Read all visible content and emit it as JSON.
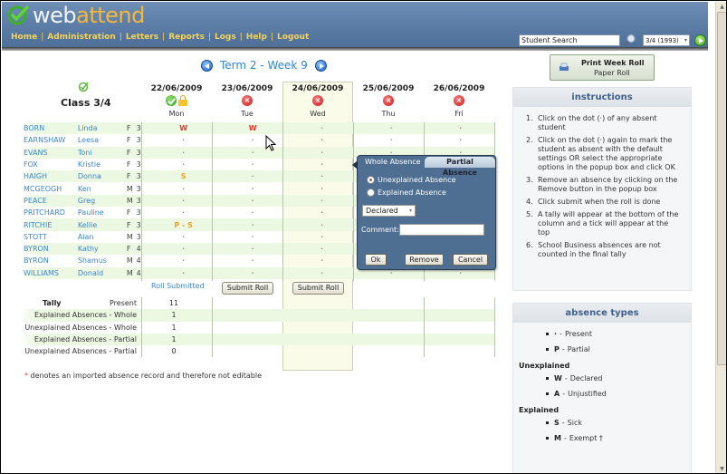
{
  "app": {
    "logo_part1": "web",
    "logo_part2": "attend"
  },
  "nav": {
    "items": [
      "Home",
      "Administration",
      "Letters",
      "Reports",
      "Logs",
      "Help",
      "Logout"
    ],
    "separator": "|"
  },
  "search": {
    "value": "Student Search",
    "placeholder": "Student Search"
  },
  "class_select": {
    "selected": "3/4 (1993)"
  },
  "week": {
    "title": "Term 2 - Week 9"
  },
  "class": {
    "title": "Class 3/4"
  },
  "days": [
    {
      "date": "22/06/2009",
      "name": "Mon",
      "status": "submitted",
      "locked": true
    },
    {
      "date": "23/06/2009",
      "name": "Tue",
      "status": "not-submitted",
      "locked": false
    },
    {
      "date": "24/06/2009",
      "name": "Wed",
      "status": "not-submitted",
      "locked": false
    },
    {
      "date": "25/06/2009",
      "name": "Thu",
      "status": "not-submitted",
      "locked": false
    },
    {
      "date": "26/06/2009",
      "name": "Fri",
      "status": "not-submitted",
      "locked": false
    }
  ],
  "students": [
    {
      "last": "BORN",
      "first": "Linda",
      "gender": "F",
      "year": "3",
      "marks": [
        "W",
        "W",
        "·",
        "·",
        "·"
      ]
    },
    {
      "last": "EARNSHAW",
      "first": "Leesa",
      "gender": "F",
      "year": "3",
      "marks": [
        "·",
        "·",
        "·",
        "·",
        "·"
      ]
    },
    {
      "last": "EVANS",
      "first": "Toni",
      "gender": "F",
      "year": "3",
      "marks": [
        "·",
        "·",
        "·",
        "·",
        "·"
      ]
    },
    {
      "last": "FOX",
      "first": "Kristie",
      "gender": "F",
      "year": "3",
      "marks": [
        "·",
        "·",
        "·",
        "·",
        "·"
      ]
    },
    {
      "last": "HAIGH",
      "first": "Donna",
      "gender": "F",
      "year": "3",
      "marks": [
        "S",
        "·",
        "·",
        "·",
        "·"
      ]
    },
    {
      "last": "MCGEOGH",
      "first": "Ken",
      "gender": "M",
      "year": "3",
      "marks": [
        "·",
        "·",
        "·",
        "·",
        "·"
      ]
    },
    {
      "last": "PEACE",
      "first": "Greg",
      "gender": "M",
      "year": "3",
      "marks": [
        "·",
        "·",
        "·",
        "·",
        "·"
      ]
    },
    {
      "last": "PRITCHARD",
      "first": "Pauline",
      "gender": "F",
      "year": "3",
      "marks": [
        "·",
        "·",
        "·",
        "·",
        "·"
      ]
    },
    {
      "last": "RITCHIE",
      "first": "Kellie",
      "gender": "F",
      "year": "3",
      "marks": [
        "P - S",
        "·",
        "·",
        "·",
        "·"
      ]
    },
    {
      "last": "STOTT",
      "first": "Alan",
      "gender": "M",
      "year": "3",
      "marks": [
        "·",
        "·",
        "·",
        "·",
        "·"
      ]
    },
    {
      "last": "BYRON",
      "first": "Kathy",
      "gender": "F",
      "year": "4",
      "marks": [
        "·",
        "·",
        "·",
        "·",
        "·"
      ]
    },
    {
      "last": "BYRON",
      "first": "Shamus",
      "gender": "M",
      "year": "4",
      "marks": [
        "·",
        "·",
        "·",
        "·",
        "·"
      ]
    },
    {
      "last": "WILLIAMS",
      "first": "Donald",
      "gender": "M",
      "year": "4",
      "marks": [
        "·",
        "·",
        "·",
        "·",
        "·"
      ]
    }
  ],
  "roll": {
    "submitted_label": "Roll Submitted",
    "submit_label": "Submit Roll"
  },
  "tally": {
    "title": "Tally",
    "rows": [
      {
        "label": "Present",
        "value": "11"
      },
      {
        "label": "Explained Absences - Whole",
        "value": "1"
      },
      {
        "label": "Unexplained Absences - Whole",
        "value": "1"
      },
      {
        "label": "Explained Absences - Partial",
        "value": "1"
      },
      {
        "label": "Unexplained Absences - Partial",
        "value": "0"
      }
    ]
  },
  "footnote": {
    "star": "*",
    "text": "denotes an imported absence record and therefore not editable"
  },
  "popup": {
    "tab_whole": "Whole Absence",
    "tab_partial": "Partial Absence",
    "radio_unexplained": "Unexplained Absence",
    "radio_explained": "Explained Absence",
    "selected_radio": "unexplained",
    "reason_selected": "Declared",
    "comment_label": "Comment:",
    "comment_value": "",
    "ok_label": "Ok",
    "remove_label": "Remove",
    "cancel_label": "Cancel"
  },
  "print": {
    "title": "Print Week Roll",
    "subtitle": "Paper Roll"
  },
  "instructions": {
    "title": "instructions",
    "items": [
      "Click on the dot (·) of any absent student",
      "Click on the dot (·) again to mark the student as absent with the default settings OR select the appropriate options in the popup box and click OK",
      "Remove an absence by clicking on the Remove button in the popup box",
      "Click submit when the roll is done",
      "A tally will appear at the bottom of the column and a tick will appear at the top",
      "School Business absences are not counted in the final tally"
    ]
  },
  "absence_types": {
    "title": "absence types",
    "general": [
      {
        "code": "·",
        "desc": "Present"
      },
      {
        "code": "P",
        "desc": "Partial"
      }
    ],
    "unexplained_title": "Unexplained",
    "unexplained": [
      {
        "code": "W",
        "desc": "Declared"
      },
      {
        "code": "A",
        "desc": "Unjustified"
      }
    ],
    "explained_title": "Explained",
    "explained": [
      {
        "code": "S",
        "desc": "Sick"
      },
      {
        "code": "M",
        "desc": "Exempt †"
      }
    ]
  },
  "colors": {
    "header_blue": "#5d7fa8",
    "nav_yellow": "#f4d35a",
    "link_blue": "#3a86d2",
    "absent_red": "#e8332c",
    "explained_orange": "#f0a21e",
    "row_green": "#edf8e2",
    "popup_blue": "#4e6f92"
  }
}
